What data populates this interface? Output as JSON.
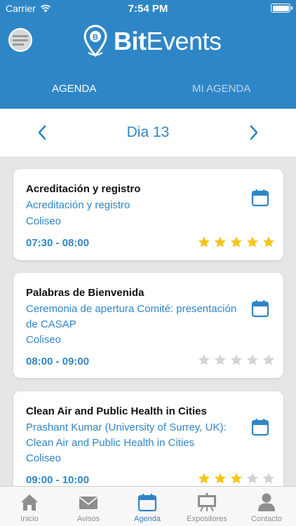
{
  "status": {
    "carrier": "Carrier",
    "time": "7:54 PM"
  },
  "app": {
    "logo_prefix": "Bit",
    "logo_suffix": "Events"
  },
  "tabs": {
    "agenda": "AGENDA",
    "my_agenda": "MI AGENDA"
  },
  "day": {
    "title": "Dia 13"
  },
  "events": [
    {
      "title": "Acreditación y registro",
      "subtitle": "Acreditación y registro",
      "location": "Coliseo",
      "time": "07:30 - 08:00",
      "rating": 5
    },
    {
      "title": "Palabras de Bienvenida",
      "subtitle": "Ceremonia de apertura Comité: presentación de CASAP",
      "location": "Coliseo",
      "time": "08:00 - 09:00",
      "rating": 0
    },
    {
      "title": "Clean Air and Public Health in Cities",
      "subtitle": "Prashant Kumar (University of Surrey, UK): Clean Air and Public Health in Cities",
      "location": "Coliseo",
      "time": "09:00 - 10:00",
      "rating": 3
    }
  ],
  "tabbar": {
    "home": "Inicio",
    "notices": "Avisos",
    "agenda": "Agenda",
    "exhibitors": "Expositores",
    "contact": "Contacto"
  },
  "colors": {
    "primary": "#2f86c6",
    "star_on": "#f5c518",
    "star_off": "#d3d3d3"
  }
}
